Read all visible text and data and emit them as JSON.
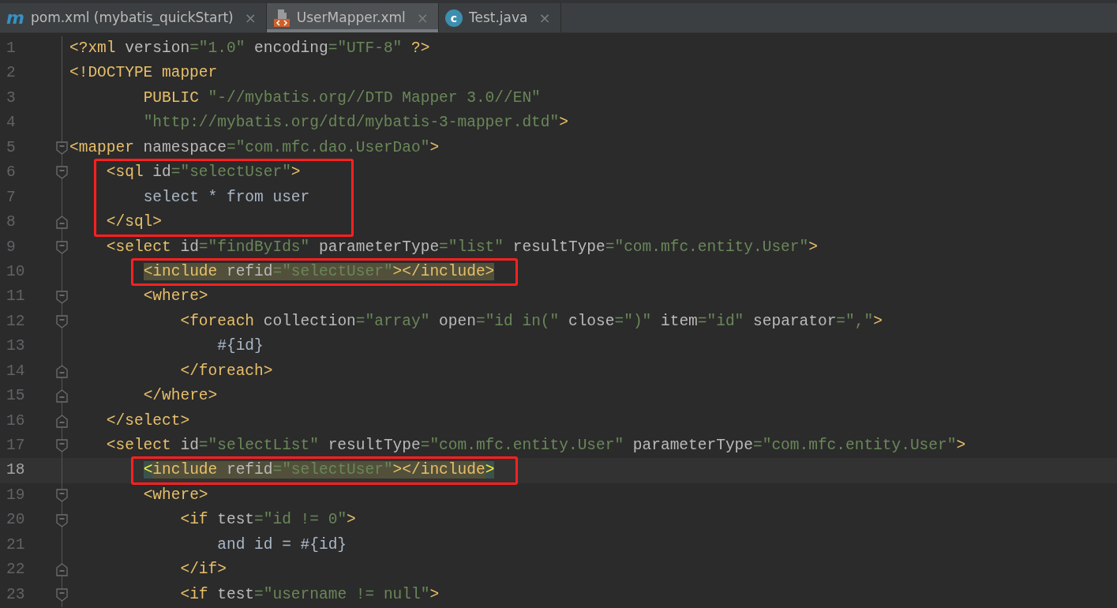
{
  "tabs": [
    {
      "label": "pom.xml (mybatis_quickStart)",
      "selected": false,
      "kind": "maven",
      "icon_text": "m",
      "close": "×"
    },
    {
      "label": "UserMapper.xml",
      "selected": true,
      "kind": "xml",
      "close": "×"
    },
    {
      "label": "Test.java",
      "selected": false,
      "kind": "java",
      "icon_text": "c",
      "close": "×"
    }
  ],
  "lines": [
    {
      "number": "1",
      "tokens": [
        {
          "kind": "tag",
          "text": "<?xml"
        },
        {
          "kind": "attr",
          "text": " version"
        },
        {
          "kind": "value",
          "text": "=\"1.0\""
        },
        {
          "kind": "attr",
          "text": " encoding"
        },
        {
          "kind": "value",
          "text": "=\"UTF-8\""
        },
        {
          "kind": "tag",
          "text": " ?>"
        }
      ]
    },
    {
      "number": "2",
      "tokens": [
        {
          "kind": "tag",
          "text": "<!DOCTYPE mapper"
        }
      ]
    },
    {
      "number": "3",
      "tokens": [
        {
          "kind": "tag",
          "text": "        PUBLIC "
        },
        {
          "kind": "value",
          "text": "\"-//mybatis.org//DTD Mapper 3.0//EN\""
        }
      ]
    },
    {
      "number": "4",
      "tokens": [
        {
          "kind": "value",
          "text": "        \"http://mybatis.org/dtd/mybatis-3-mapper.dtd\""
        },
        {
          "kind": "tag",
          "text": ">"
        }
      ]
    },
    {
      "number": "5",
      "fold_open": true,
      "tokens": [
        {
          "kind": "tag",
          "text": "<mapper"
        },
        {
          "kind": "attr",
          "text": " namespace"
        },
        {
          "kind": "value",
          "text": "=\"com.mfc.dao.UserDao\""
        },
        {
          "kind": "tag",
          "text": ">"
        }
      ]
    },
    {
      "number": "6",
      "fold_open": true,
      "boxed": true,
      "tokens": [
        {
          "kind": "tag",
          "text": "    <sql"
        },
        {
          "kind": "attr",
          "text": " id"
        },
        {
          "kind": "value",
          "text": "=\"selectUser\""
        },
        {
          "kind": "tag",
          "text": ">"
        }
      ]
    },
    {
      "number": "7",
      "boxed": true,
      "tokens": [
        {
          "kind": "text",
          "text": "        select * from user"
        }
      ]
    },
    {
      "number": "8",
      "fold_close": true,
      "boxed": true,
      "tokens": [
        {
          "kind": "tag",
          "text": "    </sql>"
        }
      ]
    },
    {
      "number": "9",
      "fold_open": true,
      "tokens": [
        {
          "kind": "tag",
          "text": "    <select"
        },
        {
          "kind": "attr",
          "text": " id"
        },
        {
          "kind": "value",
          "text": "=\"findByIds\""
        },
        {
          "kind": "attr",
          "text": " parameterType"
        },
        {
          "kind": "value",
          "text": "=\"list\""
        },
        {
          "kind": "attr",
          "text": " resultType"
        },
        {
          "kind": "value",
          "text": "=\"com.mfc.entity.User\""
        },
        {
          "kind": "tag",
          "text": ">"
        }
      ]
    },
    {
      "number": "10",
      "highlight": true,
      "boxed": true,
      "tokens": [
        {
          "kind": "tag",
          "text": "        <include"
        },
        {
          "kind": "attr",
          "text": " refid"
        },
        {
          "kind": "value",
          "text": "=\"selectUser\""
        },
        {
          "kind": "tag",
          "text": "></include>"
        }
      ]
    },
    {
      "number": "11",
      "fold_open": true,
      "tokens": [
        {
          "kind": "tag",
          "text": "        <where>"
        }
      ]
    },
    {
      "number": "12",
      "fold_open": true,
      "tokens": [
        {
          "kind": "tag",
          "text": "            <foreach"
        },
        {
          "kind": "attr",
          "text": " collection"
        },
        {
          "kind": "value",
          "text": "=\"array\""
        },
        {
          "kind": "attr",
          "text": " open"
        },
        {
          "kind": "value",
          "text": "=\"id in(\""
        },
        {
          "kind": "attr",
          "text": " close"
        },
        {
          "kind": "value",
          "text": "=\")\""
        },
        {
          "kind": "attr",
          "text": " item"
        },
        {
          "kind": "value",
          "text": "=\"id\""
        },
        {
          "kind": "attr",
          "text": " separator"
        },
        {
          "kind": "value",
          "text": "=\",\""
        },
        {
          "kind": "tag",
          "text": ">"
        }
      ]
    },
    {
      "number": "13",
      "tokens": [
        {
          "kind": "text",
          "text": "                #{id}"
        }
      ]
    },
    {
      "number": "14",
      "fold_close": true,
      "tokens": [
        {
          "kind": "tag",
          "text": "            </foreach>"
        }
      ]
    },
    {
      "number": "15",
      "fold_close": true,
      "tokens": [
        {
          "kind": "tag",
          "text": "        </where>"
        }
      ]
    },
    {
      "number": "16",
      "fold_close": true,
      "tokens": [
        {
          "kind": "tag",
          "text": "    </select>"
        }
      ]
    },
    {
      "number": "17",
      "fold_open": true,
      "tokens": [
        {
          "kind": "tag",
          "text": "    <select"
        },
        {
          "kind": "attr",
          "text": " id"
        },
        {
          "kind": "value",
          "text": "=\"selectList\""
        },
        {
          "kind": "attr",
          "text": " resultType"
        },
        {
          "kind": "value",
          "text": "=\"com.mfc.entity.User\""
        },
        {
          "kind": "attr",
          "text": " parameterType"
        },
        {
          "kind": "value",
          "text": "=\"com.mfc.entity.User\""
        },
        {
          "kind": "tag",
          "text": ">"
        }
      ]
    },
    {
      "number": "18",
      "current": true,
      "highlight": true,
      "boxed": true,
      "tokens": [
        {
          "kind": "match",
          "text": "        <"
        },
        {
          "kind": "tag",
          "text": "include"
        },
        {
          "kind": "attr",
          "text": " refid"
        },
        {
          "kind": "value",
          "text": "=\"selectUser\""
        },
        {
          "kind": "tag",
          "text": "></include"
        },
        {
          "kind": "match",
          "text": ">"
        }
      ]
    },
    {
      "number": "19",
      "fold_open": true,
      "tokens": [
        {
          "kind": "tag",
          "text": "        <where>"
        }
      ]
    },
    {
      "number": "20",
      "fold_open": true,
      "tokens": [
        {
          "kind": "tag",
          "text": "            <if"
        },
        {
          "kind": "attr",
          "text": " test"
        },
        {
          "kind": "value",
          "text": "=\"id != 0\""
        },
        {
          "kind": "tag",
          "text": ">"
        }
      ]
    },
    {
      "number": "21",
      "tokens": [
        {
          "kind": "text",
          "text": "                and id = #{id}"
        }
      ]
    },
    {
      "number": "22",
      "fold_close": true,
      "tokens": [
        {
          "kind": "tag",
          "text": "            </if>"
        }
      ]
    },
    {
      "number": "23",
      "fold_open": true,
      "tokens": [
        {
          "kind": "tag",
          "text": "            <if"
        },
        {
          "kind": "attr",
          "text": " test"
        },
        {
          "kind": "value",
          "text": "=\"username != null\""
        },
        {
          "kind": "tag",
          "text": ">"
        }
      ]
    }
  ]
}
